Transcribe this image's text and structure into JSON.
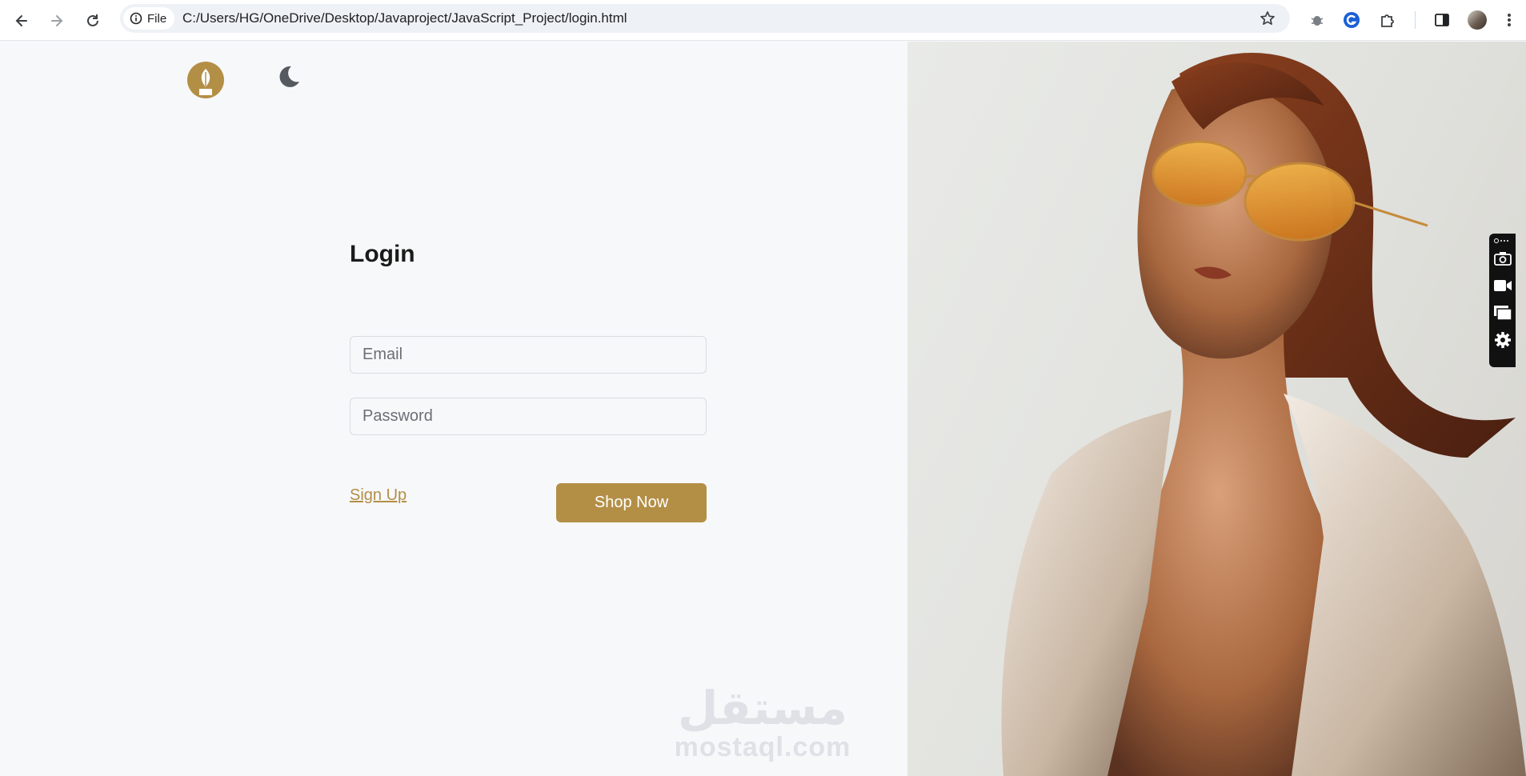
{
  "browser": {
    "site_chip": "File",
    "url": "C:/Users/HG/OneDrive/Desktop/Javaproject/JavaScript_Project/login.html"
  },
  "page": {
    "title": "Login",
    "email_placeholder": "Email",
    "password_placeholder": "Password",
    "signup_label": "Sign Up",
    "shop_button": "Shop Now"
  },
  "watermark": {
    "arabic": "مستقل",
    "latin": "mostaql.com"
  },
  "colors": {
    "accent": "#b38f46",
    "background": "#f7f8fa"
  },
  "icons": [
    "back-arrow-icon",
    "forward-arrow-icon",
    "reload-icon",
    "info-icon",
    "star-icon",
    "bug-extension-icon",
    "grammarly-icon",
    "puzzle-icon",
    "side-panel-icon",
    "profile-avatar",
    "kebab-menu-icon",
    "leaf-logo",
    "moon-icon",
    "camera-icon",
    "video-icon",
    "window-icon",
    "gear-icon"
  ]
}
